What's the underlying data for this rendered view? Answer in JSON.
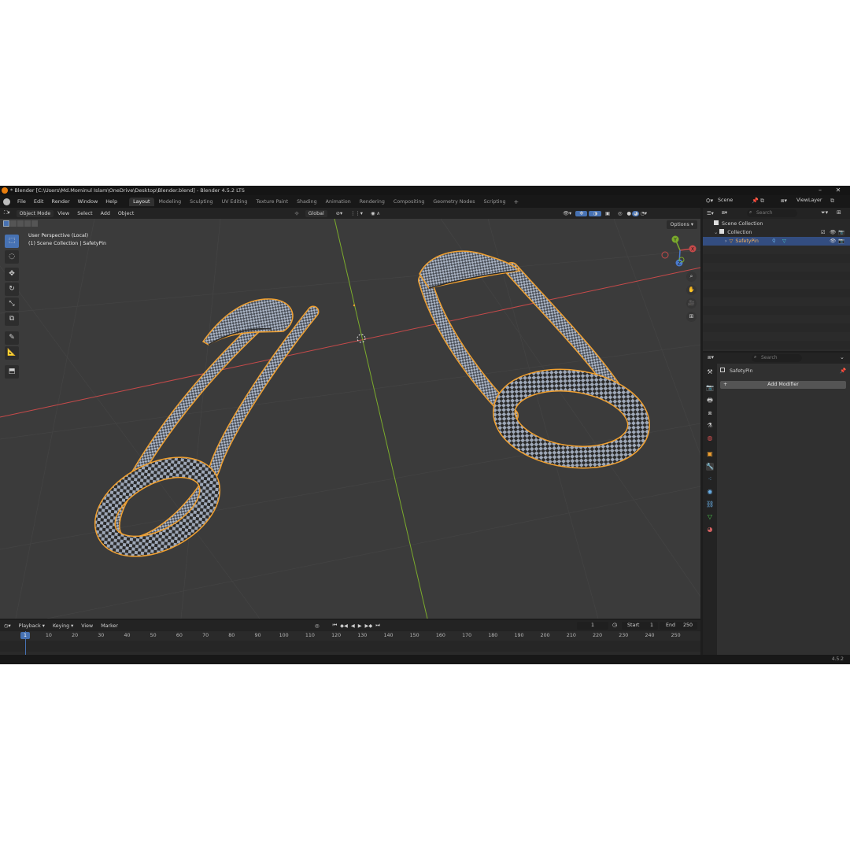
{
  "window": {
    "title": "* Blender [C:\\Users\\Md.Mominul Islam\\OneDrive\\Desktop\\Blender.blend] - Blender 4.5.2 LTS",
    "minimize": "–",
    "maximize": "▢",
    "close": "✕"
  },
  "menu": [
    "File",
    "Edit",
    "Render",
    "Window",
    "Help"
  ],
  "workspaces": [
    "Layout",
    "Modeling",
    "Sculpting",
    "UV Editing",
    "Texture Paint",
    "Shading",
    "Animation",
    "Rendering",
    "Compositing",
    "Geometry Nodes",
    "Scripting"
  ],
  "workspace_add": "+",
  "viewport_header": {
    "mode": "Object Mode",
    "menus": [
      "View",
      "Select",
      "Add",
      "Object"
    ],
    "orientation": "Global"
  },
  "viewport": {
    "perspective": "User Perspective (Local)",
    "collection": "(1) Scene Collection | SafetyPin",
    "options": "Options",
    "gizmo": {
      "x": "X",
      "y": "Y",
      "z": "Z"
    }
  },
  "timeline": {
    "menus": [
      "Playback",
      "Keying",
      "View",
      "Marker"
    ],
    "current_frame": "1",
    "start_label": "Start",
    "start_value": "1",
    "end_label": "End",
    "end_value": "250",
    "ticks": [
      "1",
      "10",
      "20",
      "30",
      "40",
      "50",
      "60",
      "70",
      "80",
      "90",
      "100",
      "110",
      "120",
      "130",
      "140",
      "150",
      "160",
      "170",
      "180",
      "190",
      "200",
      "210",
      "220",
      "230",
      "240",
      "250"
    ]
  },
  "outliner": {
    "scene": "Scene",
    "view_layer": "ViewLayer",
    "search_placeholder": "Search",
    "rows": [
      "Scene Collection",
      "Collection",
      "SafetyPin"
    ]
  },
  "properties": {
    "search_placeholder": "Search",
    "object_name": "SafetyPin",
    "add_modifier": "Add Modifier"
  },
  "status": {
    "version": "4.5.2"
  },
  "colors": {
    "accent": "#4772b3",
    "selection_outline": "#f0a030",
    "axis_x": "#c74a4a",
    "axis_y": "#7bab2c"
  }
}
